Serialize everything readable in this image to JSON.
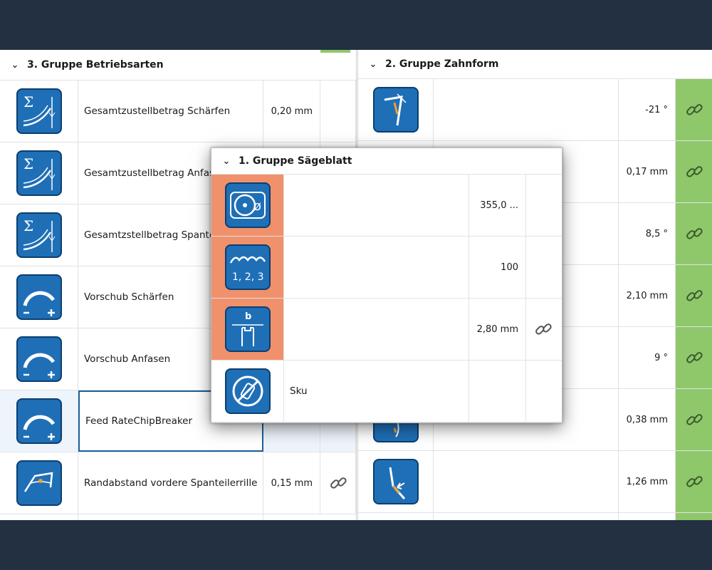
{
  "left_group": {
    "title": "3. Gruppe Betriebsarten",
    "rows": [
      {
        "icon": "sum-infeed-icon",
        "label": "Gesamtzustellbetrag Schärfen",
        "value": "0,20 mm"
      },
      {
        "icon": "sum-infeed-icon",
        "label": "Gesamtzustellbetrag Anfasen",
        "value": ""
      },
      {
        "icon": "sum-infeed-icon",
        "label": "Gesamtzstellbetrag Spanteiler",
        "value": ""
      },
      {
        "icon": "feed-rate-gauge-icon",
        "label": "Vorschub Schärfen",
        "value": ""
      },
      {
        "icon": "feed-rate-gauge-icon",
        "label": "Vorschub Anfasen",
        "value": ""
      },
      {
        "icon": "feed-rate-gauge-icon",
        "label": "Feed RateChipBreaker",
        "value": ""
      },
      {
        "icon": "chip-breaker-groove-icon",
        "label": "Randabstand vordere Spanteilerrille",
        "value": "0,15 mm",
        "linked": true
      }
    ]
  },
  "right_group": {
    "title": "2. Gruppe Zahnform",
    "rows": [
      {
        "icon": "tooth-angle-icon",
        "value": "-21 °"
      },
      {
        "icon": "tooth-form-icon",
        "value": "0,17 mm"
      },
      {
        "icon": "tooth-form-icon",
        "value": "8,5 °"
      },
      {
        "icon": "tooth-form-icon",
        "value": "2,10 mm"
      },
      {
        "icon": "tooth-form-icon",
        "value": "9 °"
      },
      {
        "icon": "tooth-form-icon",
        "value": "0,38 mm"
      },
      {
        "icon": "tooth-bevel-icon",
        "value": "1,26 mm"
      }
    ]
  },
  "popup": {
    "title": "1. Gruppe Sägeblatt",
    "rows": [
      {
        "icon": "blade-diameter-icon",
        "label": "",
        "value": "355,0 ...",
        "highlight": true
      },
      {
        "icon": "tooth-count-icon",
        "label": "",
        "value": "100",
        "highlight": true
      },
      {
        "icon": "blade-width-icon",
        "label": "",
        "value": "2,80 mm",
        "highlight": true,
        "linked": true
      },
      {
        "icon": "material-sku-icon",
        "label": "Sku",
        "value": "",
        "highlight": false
      }
    ],
    "icon_text": {
      "tooth_count": "1, 2, 3",
      "width_letter": "b"
    }
  },
  "colors": {
    "accent_blue": "#1f6fb7",
    "highlight_orange": "#f0916c",
    "link_green": "#8fc86b",
    "frame": "#223041"
  }
}
